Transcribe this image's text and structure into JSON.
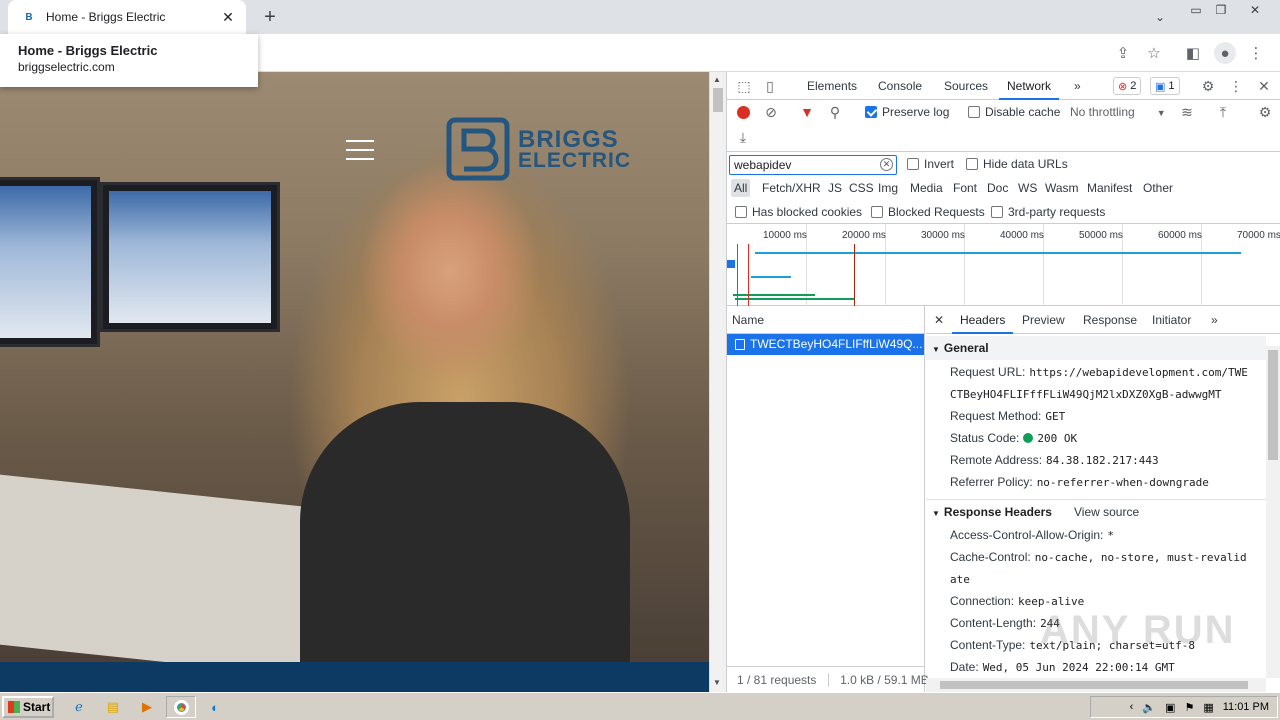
{
  "browser": {
    "tab_title": "Home - Briggs Electric",
    "tab_close": "✕",
    "new_tab": "+",
    "hovercard": {
      "title": "Home - Briggs Electric",
      "url": "briggselectric.com"
    }
  },
  "website": {
    "logo_line1": "BRIGGS",
    "logo_line2": "ELECTRIC",
    "brand_color": "#24567f",
    "footer_color": "#0d3a63"
  },
  "devtools": {
    "tabs": [
      "Elements",
      "Console",
      "Sources",
      "Network"
    ],
    "active_tab": "Network",
    "more_tabs": "»",
    "errors_count": "2",
    "messages_count": "1",
    "close": "✕",
    "toolbar": {
      "preserve_log": "Preserve log",
      "disable_cache": "Disable cache",
      "throttling": "No throttling"
    },
    "filter": {
      "value": "webapidev",
      "invert": "Invert",
      "hide_data_urls": "Hide data URLs",
      "types": [
        "All",
        "Fetch/XHR",
        "JS",
        "CSS",
        "Img",
        "Media",
        "Font",
        "Doc",
        "WS",
        "Wasm",
        "Manifest",
        "Other"
      ],
      "has_blocked_cookies": "Has blocked cookies",
      "blocked_requests": "Blocked Requests",
      "third_party": "3rd-party requests"
    },
    "overview_ticks": [
      "10000 ms",
      "20000 ms",
      "30000 ms",
      "40000 ms",
      "50000 ms",
      "60000 ms",
      "70000 ms"
    ],
    "name_header": "Name",
    "request_name": "TWECTBeyHO4FLIFffLiW49Q...",
    "status_bar": {
      "requests": "1 / 81 requests",
      "transferred": "1.0 kB / 59.1 MB"
    },
    "detail_tabs": [
      "Headers",
      "Preview",
      "Response",
      "Initiator"
    ],
    "general": {
      "title": "General",
      "request_url_key": "Request URL:",
      "request_url_line1": "https://webapidevelopment.com/TWE",
      "request_url_line2": "CTBeyHO4FLIFffFLiW49QjM2lxDXZ0XgB-adwwgMT",
      "request_method_key": "Request Method:",
      "request_method": "GET",
      "status_code_key": "Status Code:",
      "status_code": "200 OK",
      "remote_address_key": "Remote Address:",
      "remote_address": "84.38.182.217:443",
      "referrer_policy_key": "Referrer Policy:",
      "referrer_policy": "no-referrer-when-downgrade"
    },
    "response_headers": {
      "title": "Response Headers",
      "view_source": "View source",
      "acao_key": "Access-Control-Allow-Origin:",
      "acao": "*",
      "cache_control_key": "Cache-Control:",
      "cache_control_line1": "no-cache, no-store, must-revalid",
      "cache_control_line2": "ate",
      "connection_key": "Connection:",
      "connection": "keep-alive",
      "content_length_key": "Content-Length:",
      "content_length": "244",
      "content_type_key": "Content-Type:",
      "content_type": "text/plain; charset=utf-8",
      "date_key": "Date:",
      "date": "Wed, 05 Jun 2024 22:00:14 GMT"
    }
  },
  "taskbar": {
    "start": "Start",
    "clock": "11:01 PM"
  },
  "watermark": "ANY RUN"
}
